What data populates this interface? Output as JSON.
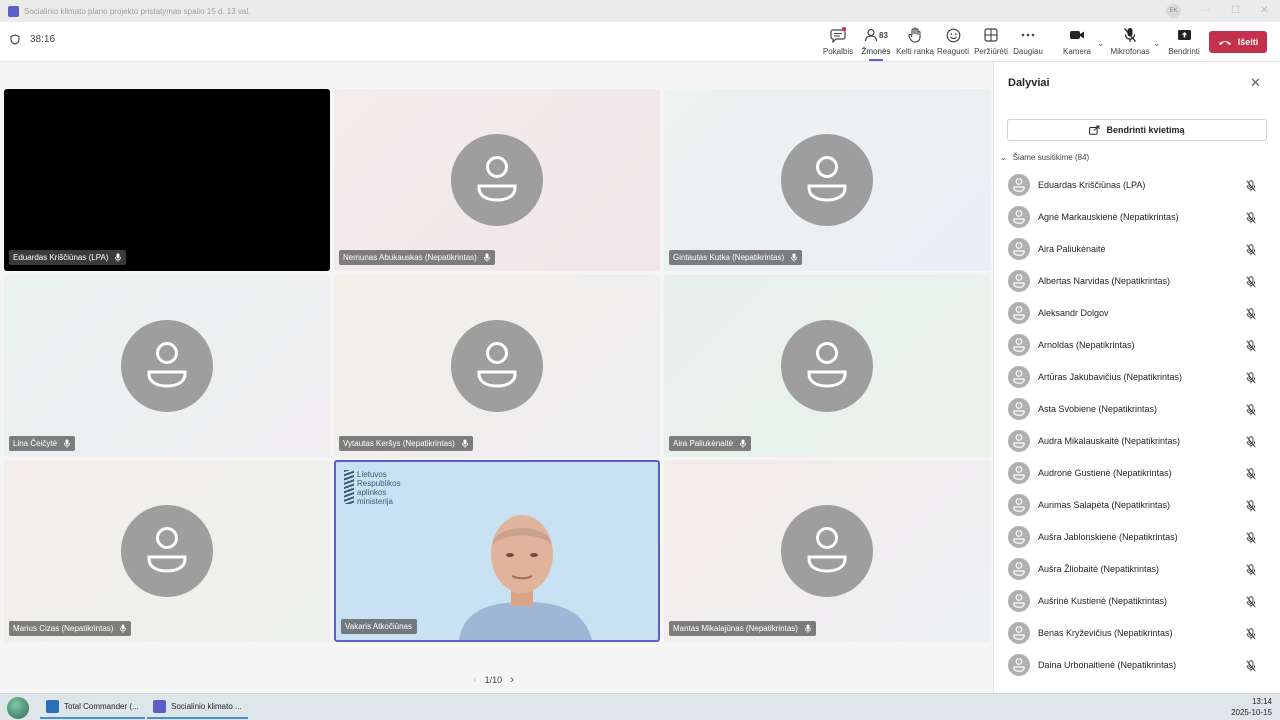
{
  "window": {
    "title": "Socialinio klimato plano projekto pristatymas spalio 15 d. 13 val.",
    "user_initials": "EK"
  },
  "toolbar": {
    "timer": "38:16",
    "chat_label": "Pokalbis",
    "people_label": "Žmonės",
    "people_count": "83",
    "raise_hand_label": "Kelti ranką",
    "react_label": "Reaguoti",
    "view_label": "Peržiūrėti",
    "more_label": "Daugiau",
    "camera_label": "Kamera",
    "mic_label": "Mikrofonas",
    "share_label": "Bendrinti",
    "leave_label": "Išeiti"
  },
  "tiles": [
    {
      "name": "Eduardas Kriščiūnas (LPA)",
      "type": "black"
    },
    {
      "name": "Nemunas Abukauskas (Nepatikrintas)",
      "type": "avatar"
    },
    {
      "name": "Gintautas Kutka (Nepatikrintas)",
      "type": "avatar"
    },
    {
      "name": "Lina Čeičytė",
      "type": "avatar"
    },
    {
      "name": "Vytautas Keršys (Nepatikrintas)",
      "type": "avatar"
    },
    {
      "name": "Aira Paliukėnaitė",
      "type": "avatar"
    },
    {
      "name": "Marius Cizas (Nepatikrintas)",
      "type": "avatar"
    },
    {
      "name": "Vakaris Atkočiūnas",
      "type": "video"
    },
    {
      "name": "Mantas Mikalajūnas (Nepatikrintas)",
      "type": "avatar"
    }
  ],
  "ministry_logo_text": [
    "Lietuvos",
    "Respublikos",
    "aplinkos",
    "ministerija"
  ],
  "pager": {
    "label": "1/10"
  },
  "panel": {
    "title": "Dalyviai",
    "share_invite_label": "Bendrinti kvietimą",
    "section_label": "Šiame susitikime (84)",
    "participants": [
      "Eduardas Kriščiūnas (LPA)",
      "Agnė Markauskienė (Nepatikrintas)",
      "Aira Paliukėnaitė",
      "Albertas Narvidas (Nepatikrintas)",
      "Aleksandr Dolgov",
      "Arnoldas (Nepatikrintas)",
      "Artūras Jakubavičius (Nepatikrintas)",
      "Asta Svobiene (Nepatikrintas)",
      "Audra Mikalauskaitė (Nepatikrintas)",
      "Audronė Gustienė (Nepatikrintas)",
      "Aurimas Salapėta (Nepatikrintas)",
      "Aušra Jablonskienė (Nepatikrintas)",
      "Aušra Žliobaitė (Nepatikrintas)",
      "Aušrinė Kustienė (Nepatikrintas)",
      "Benas Kryževičius (Nepatikrintas)",
      "Daina Urbonaitienė (Nepatikrintas)"
    ]
  },
  "taskbar": {
    "items": [
      "Total Commander (...",
      "Socialinio klimato ..."
    ],
    "time": "13:14",
    "date": "2025-10-15"
  },
  "colors": {
    "accent": "#5b5fc7",
    "leave": "#c4314b",
    "avatar": "#9e9e9e"
  }
}
